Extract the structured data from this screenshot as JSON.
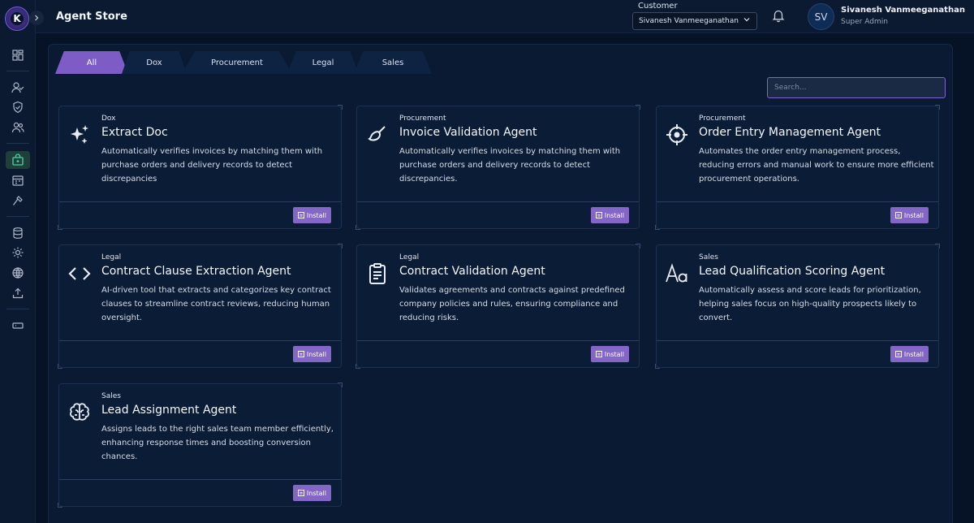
{
  "logo": {
    "letter": "K"
  },
  "header": {
    "title": "Agent Store",
    "customer_label": "Customer",
    "customer_value": "Sivanesh Vanmeeganathan",
    "user_initials": "SV",
    "user_name": "Sivanesh Vanmeeganathan",
    "user_role": "Super Admin"
  },
  "tabs": [
    "All",
    "Dox",
    "Procurement",
    "Legal",
    "Sales"
  ],
  "search": {
    "placeholder": "Search..."
  },
  "install_label": "Install",
  "cards": [
    {
      "category": "Dox",
      "title": "Extract Doc",
      "description": "Automatically verifies invoices by matching them with purchase orders and delivery records to detect discrepancies",
      "icon": "sparkles-icon"
    },
    {
      "category": "Procurement",
      "title": "Invoice Validation Agent",
      "description": "Automatically verifies invoices by matching them with purchase orders and delivery records to detect discrepancies.",
      "icon": "paintbrush-icon"
    },
    {
      "category": "Procurement",
      "title": "Order Entry Management Agent",
      "description": "Automates the order entry management process, reducing errors and manual work to ensure more efficient procurement operations.",
      "icon": "crosshair-icon"
    },
    {
      "category": "Legal",
      "title": "Contract Clause Extraction Agent",
      "description": "AI-driven tool that extracts and categorizes key contract clauses to streamline contract reviews, reducing human oversight.",
      "icon": "code-icon"
    },
    {
      "category": "Legal",
      "title": "Contract Validation Agent",
      "description": "Validates agreements and contracts against predefined company policies and rules, ensuring compliance and reducing risks.",
      "icon": "clipboard-icon"
    },
    {
      "category": "Sales",
      "title": "Lead Qualification Scoring Agent",
      "description": "Automatically assess and score leads for prioritization, helping sales focus on high-quality prospects likely to convert.",
      "icon": "text-size-icon"
    },
    {
      "category": "Sales",
      "title": "Lead Assignment Agent",
      "description": "Assigns leads to the right sales team member efficiently, enhancing response times and boosting conversion chances.",
      "icon": "brain-icon"
    }
  ]
}
